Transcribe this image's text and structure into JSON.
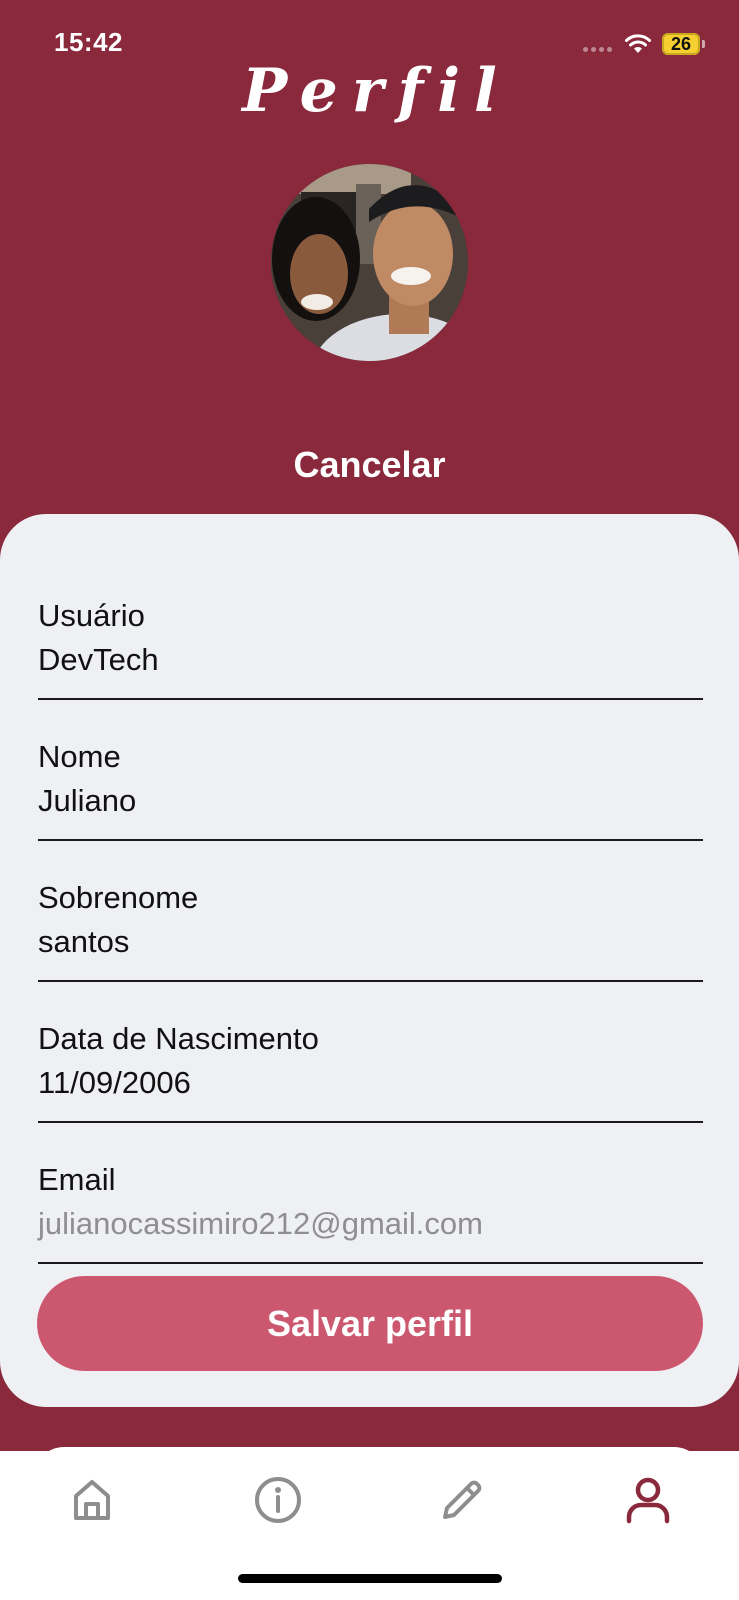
{
  "status_bar": {
    "time": "15:42",
    "battery": "26"
  },
  "header": {
    "title": "Perfil"
  },
  "actions": {
    "cancel_label": "Cancelar",
    "save_label": "Salvar perfil"
  },
  "form": {
    "fields": [
      {
        "label": "Usuário",
        "value": "DevTech"
      },
      {
        "label": "Nome",
        "value": "Juliano"
      },
      {
        "label": "Sobrenome",
        "value": "santos"
      },
      {
        "label": "Data de Nascimento",
        "value": "11/09/2006"
      },
      {
        "label": "Email",
        "value": "julianocassimiro212@gmail.com"
      }
    ]
  },
  "tab_bar": {
    "tabs": [
      {
        "icon": "home-icon",
        "active": false
      },
      {
        "icon": "info-icon",
        "active": false
      },
      {
        "icon": "pencil-icon",
        "active": false
      },
      {
        "icon": "user-icon",
        "active": true
      }
    ]
  },
  "colors": {
    "primary": "#8a283c",
    "button": "#cc5870",
    "card_background": "#eff0f4",
    "inactive_icon": "#8e8e8e"
  }
}
